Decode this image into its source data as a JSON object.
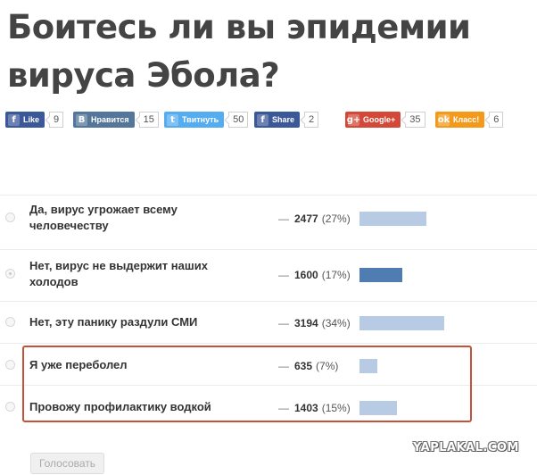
{
  "title": "Боитесь ли вы эпидемии вируса Эбола?",
  "share_buttons": [
    {
      "label": "Like",
      "count": "9",
      "icon": "f",
      "icon_name": "facebook-icon",
      "color": "#3b5998"
    },
    {
      "label": "Нравится",
      "count": "15",
      "icon": "B",
      "icon_name": "vkontakte-icon",
      "color": "#54769a"
    },
    {
      "label": "Твитнуть",
      "count": "50",
      "icon": "t",
      "icon_name": "twitter-icon",
      "color": "#55acee"
    },
    {
      "label": "Share",
      "count": "2",
      "icon": "f",
      "icon_name": "facebook-icon",
      "color": "#3b5998"
    },
    {
      "label": "Google+",
      "count": "35",
      "icon": "g+",
      "icon_name": "google-plus-icon",
      "color": "#d34836"
    },
    {
      "label": "Класс!",
      "count": "6",
      "icon": "ok",
      "icon_name": "odnoklassniki-icon",
      "color": "#f39a1d"
    }
  ],
  "poll": {
    "options": [
      {
        "label": "Да, вирус угрожает всему человечеству",
        "votes": "2477",
        "percent": "(27%)",
        "percent_value": 27,
        "selected": false
      },
      {
        "label": "Нет, вирус не выдержит наших холодов",
        "votes": "1600",
        "percent": "(17%)",
        "percent_value": 17,
        "selected": true
      },
      {
        "label": "Нет, эту панику раздули СМИ",
        "votes": "3194",
        "percent": "(34%)",
        "percent_value": 34,
        "selected": false
      },
      {
        "label": "Я уже переболел",
        "votes": "635",
        "percent": "(7%)",
        "percent_value": 7,
        "selected": false
      },
      {
        "label": "Провожу профилактику водкой",
        "votes": "1403",
        "percent": "(15%)",
        "percent_value": 15,
        "selected": false
      }
    ],
    "dash": "—",
    "vote_button": "Голосовать"
  },
  "watermark": "YAPLAKAL.COM",
  "colors": {
    "bar": "#b7cbe4",
    "bar_selected": "#4f7db1",
    "highlight": "#c0533a"
  }
}
